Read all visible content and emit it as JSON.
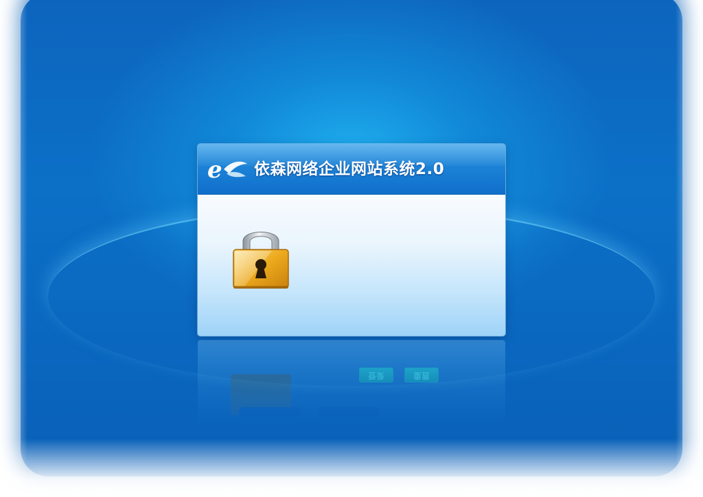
{
  "app": {
    "title": "依森网络企业网站系统2.0"
  },
  "reflection": {
    "login_label": "登录",
    "reset_label": "重置"
  },
  "icons": {
    "logo": "e-leaf-logo-icon",
    "lock": "padlock-icon"
  },
  "colors": {
    "background_blue": "#0c6cc4",
    "header_blue": "#1d84d8",
    "lock_gold": "#e8a61a",
    "body_light": "#eaf5fd"
  }
}
